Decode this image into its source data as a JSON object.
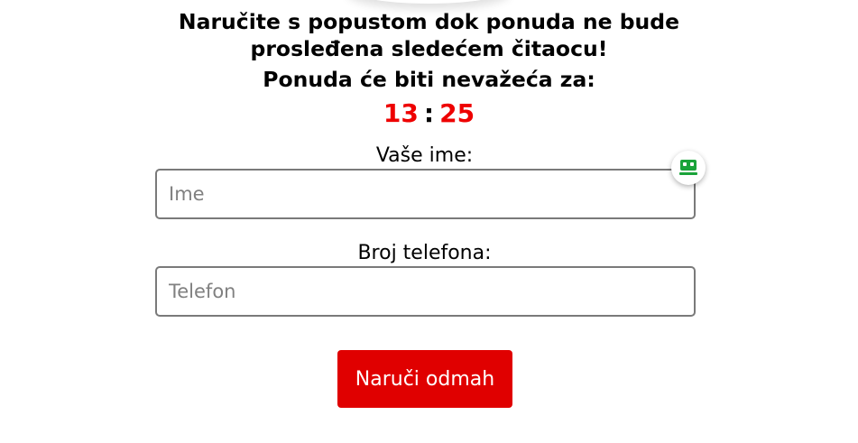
{
  "heading": {
    "line1": "Naručite s popustom dok ponuda ne bude",
    "line2": "prosleđena sledećem čitaocu!",
    "line3": "Ponuda će biti nevažeća za:"
  },
  "timer": {
    "minutes": "13",
    "separator": ":",
    "seconds": "25",
    "color": "#ee0000"
  },
  "form": {
    "name_label": "Vaše ime:",
    "name_placeholder": "Ime",
    "name_value": "",
    "phone_label": "Broj telefona:",
    "phone_placeholder": "Telefon",
    "phone_value": "",
    "submit_label": "Naruči odmah",
    "submit_color": "#e00000"
  },
  "password_manager": {
    "icon": "password-manager-icon",
    "color": "#1aa33a"
  }
}
